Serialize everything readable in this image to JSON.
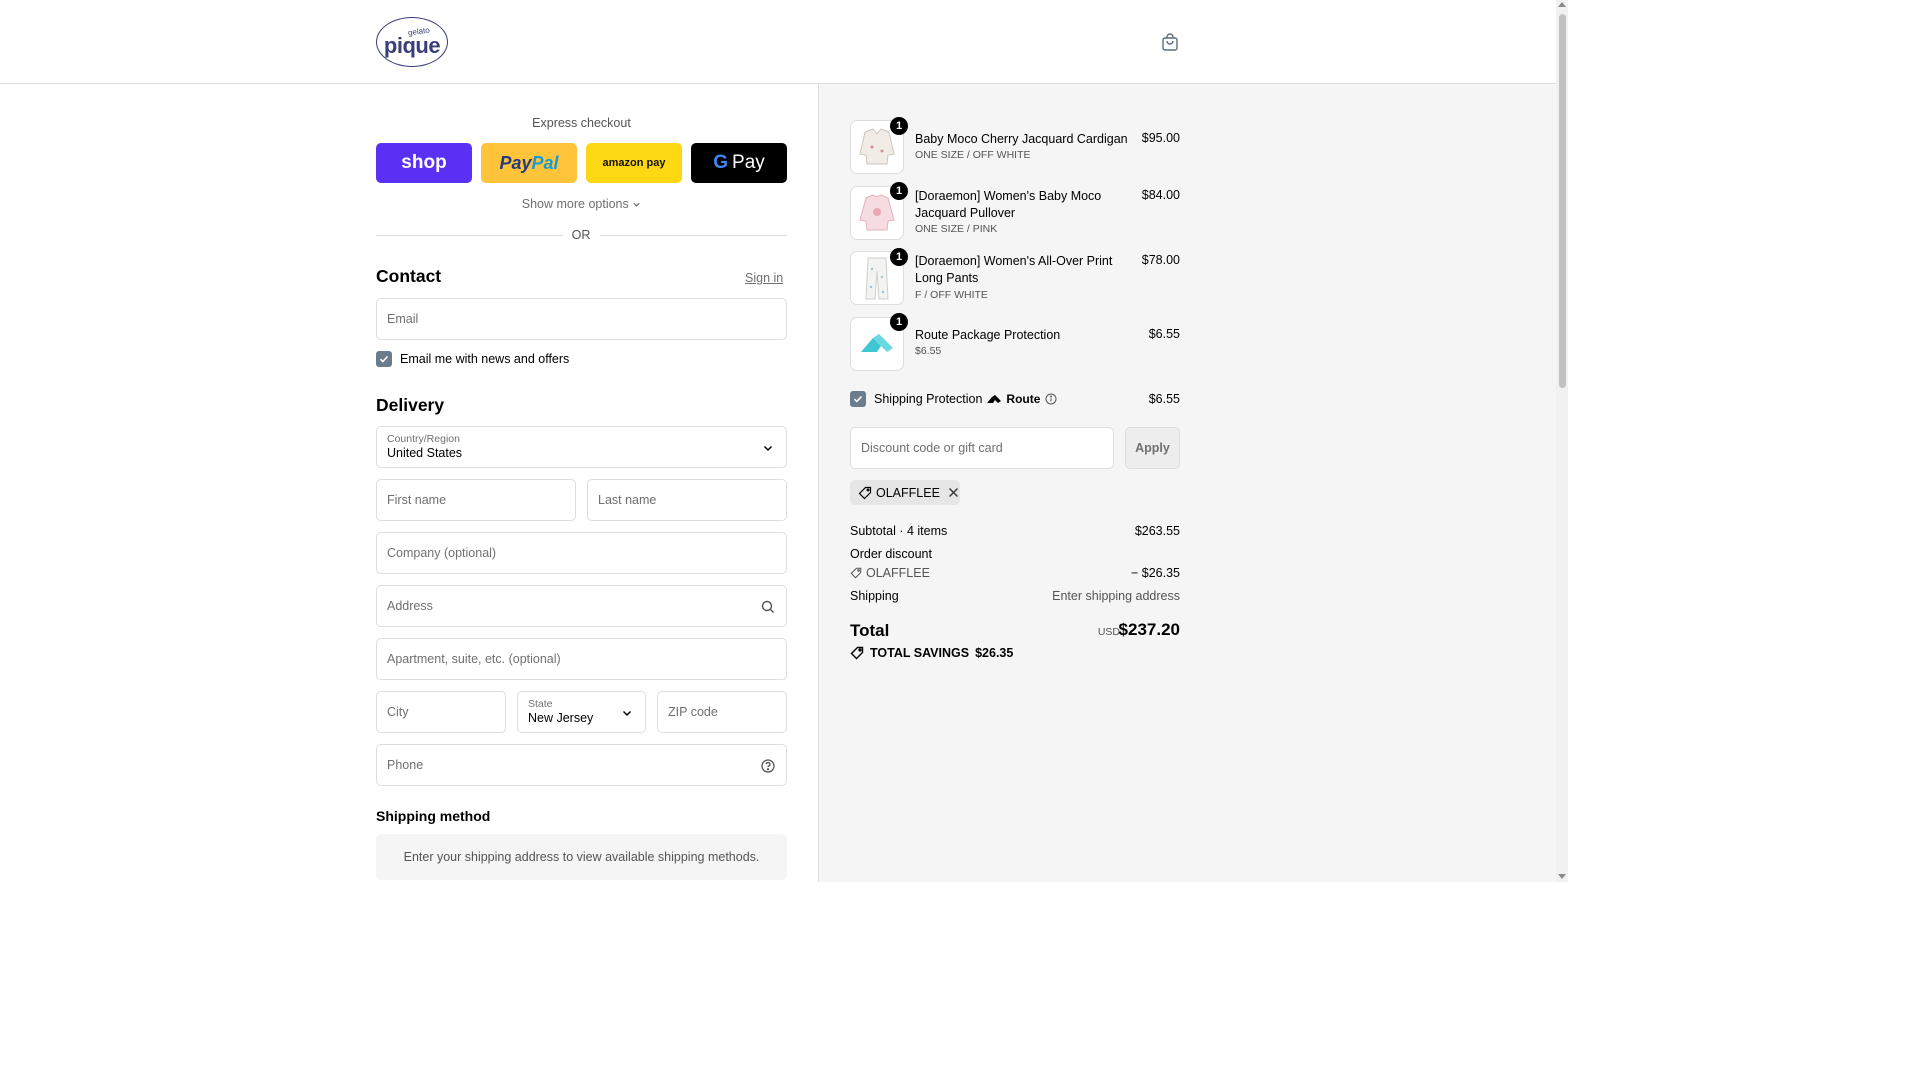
{
  "brand": {
    "top": "gelato",
    "name": "pique"
  },
  "express": {
    "title": "Express checkout",
    "buttons": {
      "shop": "shop",
      "paypal_a": "Pay",
      "paypal_b": "Pal",
      "amazon": "amazon pay",
      "gpay_g": "G",
      "gpay": "Pay"
    },
    "show_more": "Show more options",
    "or": "OR"
  },
  "contact": {
    "title": "Contact",
    "sign_in": "Sign in",
    "email_placeholder": "Email",
    "newsletter_label": "Email me with news and offers"
  },
  "delivery": {
    "title": "Delivery",
    "country_label": "Country/Region",
    "country_value": "United States",
    "first_name": "First name",
    "last_name": "Last name",
    "company": "Company (optional)",
    "address": "Address",
    "apartment": "Apartment, suite, etc. (optional)",
    "city": "City",
    "state_label": "State",
    "state_value": "New Jersey",
    "zip": "ZIP code",
    "phone": "Phone"
  },
  "shipping_method": {
    "title": "Shipping method",
    "message": "Enter your shipping address to view available shipping methods."
  },
  "cart": {
    "items": [
      {
        "qty": "1",
        "name": "Baby Moco Cherry Jacquard Cardigan",
        "variant": "ONE SIZE / OFF WHITE",
        "price": "$95.00"
      },
      {
        "qty": "1",
        "name": "[Doraemon] Women's Baby Moco Jacquard Pullover",
        "variant": "ONE SIZE / PINK",
        "price": "$84.00"
      },
      {
        "qty": "1",
        "name": "[Doraemon] Women's All-Over Print Long Pants",
        "variant": "F / OFF WHITE",
        "price": "$78.00"
      },
      {
        "qty": "1",
        "name": "Route Package Protection",
        "variant": "$6.55",
        "price": "$6.55"
      }
    ],
    "protection": {
      "label": "Shipping Protection",
      "brand": "Route",
      "price": "$6.55"
    },
    "discount_placeholder": "Discount code or gift card",
    "apply": "Apply",
    "applied_code": "OLAFFLEE",
    "subtotal_label": "Subtotal · 4 items",
    "subtotal_value": "$263.55",
    "order_discount_label": "Order discount",
    "discount_code": "OLAFFLEE",
    "discount_value": "− $26.35",
    "shipping_label": "Shipping",
    "shipping_value": "Enter shipping address",
    "total_label": "Total",
    "currency": "USD",
    "total_value": "$237.20",
    "savings_label": "TOTAL SAVINGS",
    "savings_value": "$26.35"
  },
  "colors": {
    "shop_pay": "#5a31f4",
    "paypal": "#ffc439",
    "amazon_pay": "#ffd814",
    "checkbox": "#6b7d8c",
    "route_teal": "#3ec6d3"
  }
}
